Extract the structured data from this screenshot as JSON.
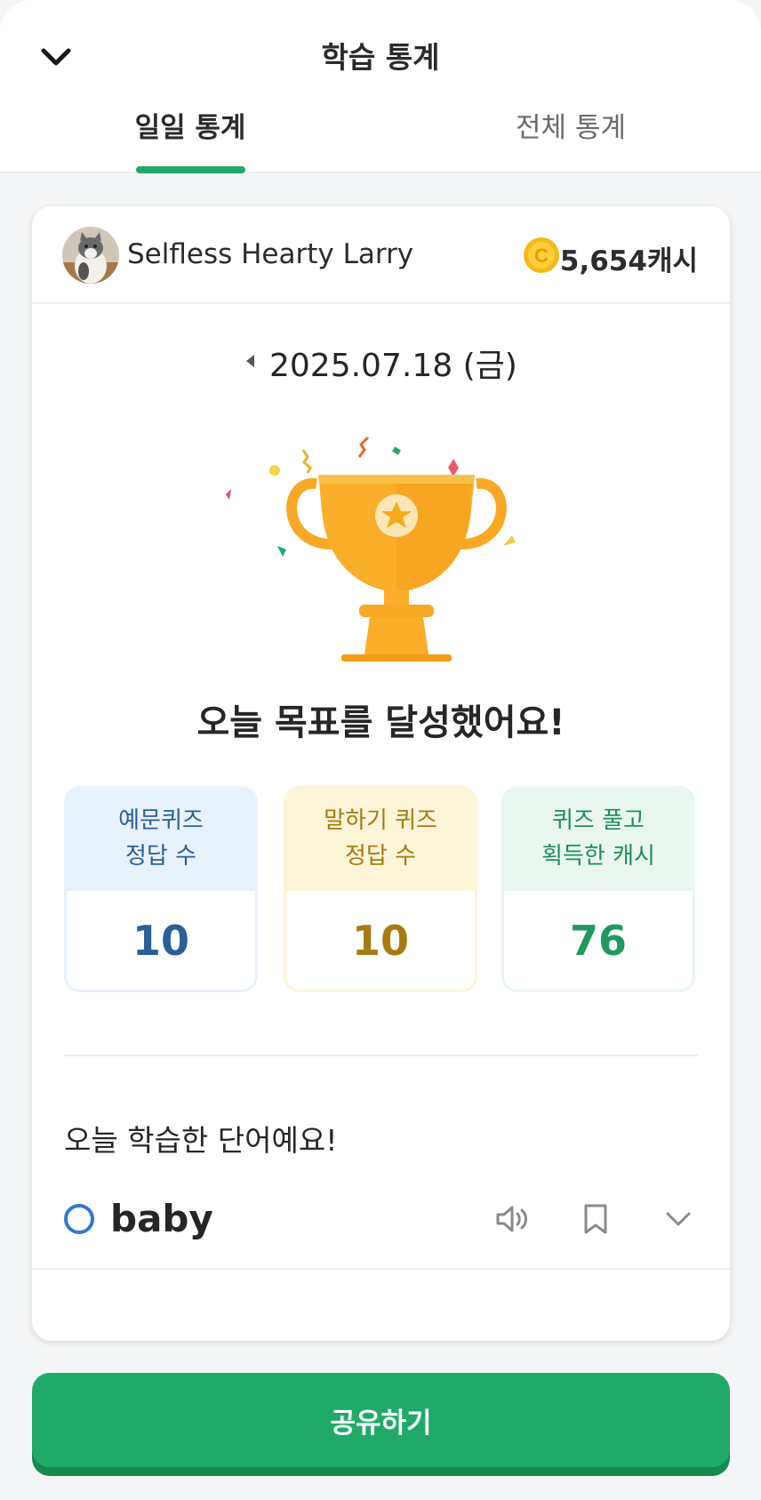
{
  "header": {
    "title": "학습 통계",
    "tabs": [
      {
        "label": "일일 통계",
        "active": true
      },
      {
        "label": "전체 통계",
        "active": false
      }
    ]
  },
  "user": {
    "name": "Selfless Hearty Larry",
    "cash": "5,654캐시"
  },
  "date": "2025.07.18 (금)",
  "goal_message": "오늘 목표를 달성했어요!",
  "stats": [
    {
      "line1": "예문퀴즈",
      "line2": "정답 수",
      "value": "10"
    },
    {
      "line1": "말하기 퀴즈",
      "line2": "정답 수",
      "value": "10"
    },
    {
      "line1": "퀴즈 풀고",
      "line2": "획득한 캐시",
      "value": "76"
    }
  ],
  "words_title": "오늘 학습한 단어예요!",
  "words": [
    {
      "word": "baby"
    }
  ],
  "share_button": "공유하기",
  "colors": {
    "accent_green": "#1fab67",
    "blue": "#2a5f99",
    "gold": "#a87a12",
    "green": "#1f9a5e"
  },
  "icons": [
    "chevron-down-icon",
    "coin-icon",
    "caret-left-icon",
    "trophy-icon",
    "speaker-icon",
    "bookmark-icon"
  ]
}
